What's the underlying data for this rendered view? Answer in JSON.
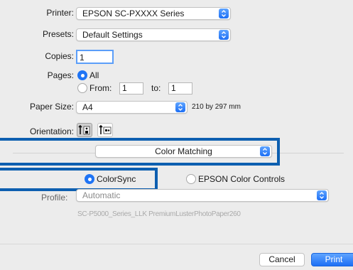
{
  "printer": {
    "label": "Printer:",
    "value": "EPSON SC-PXXXX Series"
  },
  "presets": {
    "label": "Presets:",
    "value": "Default Settings"
  },
  "copies": {
    "label": "Copies:",
    "value": "1"
  },
  "pages": {
    "label": "Pages:",
    "all_label": "All",
    "from_label": "From:",
    "from_value": "1",
    "to_label": "to:",
    "to_value": "1",
    "selected": "All"
  },
  "paper_size": {
    "label": "Paper Size:",
    "value": "A4",
    "dimensions": "210 by 297 mm"
  },
  "orientation": {
    "label": "Orientation:"
  },
  "section_popup": {
    "value": "Color Matching"
  },
  "color_mode": {
    "colorsync_label": "ColorSync",
    "epson_label": "EPSON Color Controls",
    "selected": "ColorSync"
  },
  "profile": {
    "label": "Profile:",
    "value": "Automatic",
    "description": "SC-P5000_Series_LLK PremiumLusterPhotoPaper260"
  },
  "buttons": {
    "cancel": "Cancel",
    "print": "Print"
  },
  "colors": {
    "accent": "#1f74f5",
    "highlight": "#0d5fb0"
  }
}
